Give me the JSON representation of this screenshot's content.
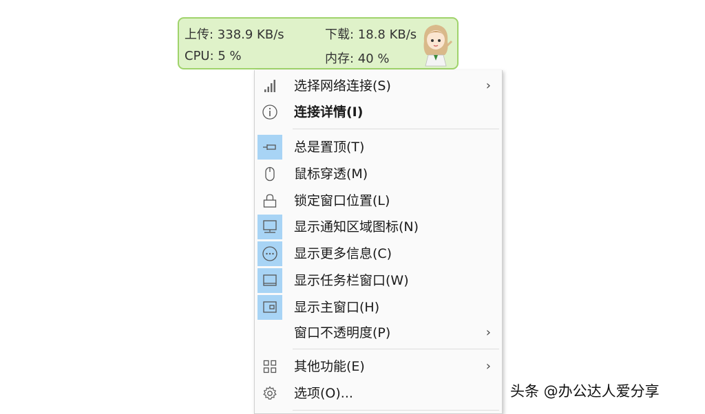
{
  "widget": {
    "upload_label": "上传: 338.9 KB/s",
    "download_label": "下载: 18.8 KB/s",
    "cpu_label": "CPU: 5 %",
    "memory_label": "内存: 40 %",
    "colors": {
      "background": "#dff2c9",
      "border": "#9fd36a"
    }
  },
  "menu": {
    "items": [
      {
        "label": "选择网络连接(S)",
        "icon": "signal-bars-icon",
        "submenu": true
      },
      {
        "label": "连接详情(I)",
        "icon": "info-icon",
        "bold": true
      },
      {
        "label": "总是置顶(T)",
        "icon": "pin-icon",
        "checked": true
      },
      {
        "label": "鼠标穿透(M)",
        "icon": "mouse-icon"
      },
      {
        "label": "锁定窗口位置(L)",
        "icon": "lock-icon"
      },
      {
        "label": "显示通知区域图标(N)",
        "icon": "tray-monitor-icon",
        "checked": true
      },
      {
        "label": "显示更多信息(C)",
        "icon": "more-circle-icon",
        "checked": true
      },
      {
        "label": "显示任务栏窗口(W)",
        "icon": "taskbar-window-icon",
        "checked": true
      },
      {
        "label": "显示主窗口(H)",
        "icon": "main-window-icon",
        "checked": true
      },
      {
        "label": "窗口不透明度(P)",
        "submenu": true
      },
      {
        "label": "其他功能(E)",
        "icon": "grid-icon",
        "submenu": true
      },
      {
        "label": "选项(O)...",
        "icon": "gear-icon"
      }
    ],
    "submenu_arrow": "›",
    "check_highlight_color": "#a8d4f5"
  },
  "watermark": "头条 @办公达人爱分享"
}
